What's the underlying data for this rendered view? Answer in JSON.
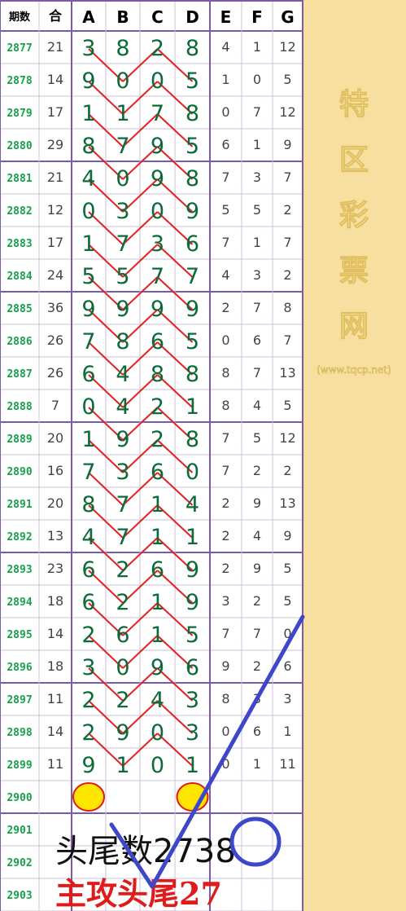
{
  "header": {
    "period": "期数",
    "sum": "合",
    "cols": [
      "A",
      "B",
      "C",
      "D",
      "E",
      "F",
      "G"
    ]
  },
  "rows": [
    {
      "period": "2877",
      "sum": "21",
      "digits": [
        3,
        8,
        2,
        8
      ],
      "efg": [
        "4",
        "1",
        "12"
      ]
    },
    {
      "period": "2878",
      "sum": "14",
      "digits": [
        9,
        0,
        0,
        5
      ],
      "efg": [
        "1",
        "0",
        "5"
      ]
    },
    {
      "period": "2879",
      "sum": "17",
      "digits": [
        1,
        1,
        7,
        8
      ],
      "efg": [
        "0",
        "7",
        "12"
      ]
    },
    {
      "period": "2880",
      "sum": "29",
      "digits": [
        8,
        7,
        9,
        5
      ],
      "efg": [
        "6",
        "1",
        "9"
      ]
    },
    {
      "period": "2881",
      "sum": "21",
      "digits": [
        4,
        0,
        9,
        8
      ],
      "efg": [
        "7",
        "3",
        "7"
      ]
    },
    {
      "period": "2882",
      "sum": "12",
      "digits": [
        0,
        3,
        0,
        9
      ],
      "efg": [
        "5",
        "5",
        "2"
      ]
    },
    {
      "period": "2883",
      "sum": "17",
      "digits": [
        1,
        7,
        3,
        6
      ],
      "efg": [
        "7",
        "1",
        "7"
      ]
    },
    {
      "period": "2884",
      "sum": "24",
      "digits": [
        5,
        5,
        7,
        7
      ],
      "efg": [
        "4",
        "3",
        "2"
      ]
    },
    {
      "period": "2885",
      "sum": "36",
      "digits": [
        9,
        9,
        9,
        9
      ],
      "efg": [
        "2",
        "7",
        "8"
      ]
    },
    {
      "period": "2886",
      "sum": "26",
      "digits": [
        7,
        8,
        6,
        5
      ],
      "efg": [
        "0",
        "6",
        "7"
      ]
    },
    {
      "period": "2887",
      "sum": "26",
      "digits": [
        6,
        4,
        8,
        8
      ],
      "efg": [
        "8",
        "7",
        "13"
      ]
    },
    {
      "period": "2888",
      "sum": "7",
      "digits": [
        0,
        4,
        2,
        1
      ],
      "efg": [
        "8",
        "4",
        "5"
      ]
    },
    {
      "period": "2889",
      "sum": "20",
      "digits": [
        1,
        9,
        2,
        8
      ],
      "efg": [
        "7",
        "5",
        "12"
      ]
    },
    {
      "period": "2890",
      "sum": "16",
      "digits": [
        7,
        3,
        6,
        0
      ],
      "efg": [
        "7",
        "2",
        "2"
      ]
    },
    {
      "period": "2891",
      "sum": "20",
      "digits": [
        8,
        7,
        1,
        4
      ],
      "efg": [
        "2",
        "9",
        "13"
      ]
    },
    {
      "period": "2892",
      "sum": "13",
      "digits": [
        4,
        7,
        1,
        1
      ],
      "efg": [
        "2",
        "4",
        "9"
      ]
    },
    {
      "period": "2893",
      "sum": "23",
      "digits": [
        6,
        2,
        6,
        9
      ],
      "efg": [
        "2",
        "9",
        "5"
      ]
    },
    {
      "period": "2894",
      "sum": "18",
      "digits": [
        6,
        2,
        1,
        9
      ],
      "efg": [
        "3",
        "2",
        "5"
      ]
    },
    {
      "period": "2895",
      "sum": "14",
      "digits": [
        2,
        6,
        1,
        5
      ],
      "efg": [
        "7",
        "7",
        "0"
      ]
    },
    {
      "period": "2896",
      "sum": "18",
      "digits": [
        3,
        0,
        9,
        6
      ],
      "efg": [
        "9",
        "2",
        "6"
      ]
    },
    {
      "period": "2897",
      "sum": "11",
      "digits": [
        2,
        2,
        4,
        3
      ],
      "efg": [
        "8",
        "3",
        "3"
      ]
    },
    {
      "period": "2898",
      "sum": "14",
      "digits": [
        2,
        9,
        0,
        3
      ],
      "efg": [
        "0",
        "6",
        "1"
      ]
    },
    {
      "period": "2899",
      "sum": "11",
      "digits": [
        9,
        1,
        0,
        1
      ],
      "efg": [
        "0",
        "1",
        "11"
      ]
    },
    {
      "period": "2900",
      "sum": "",
      "digits": [],
      "efg": [
        "",
        "",
        ""
      ]
    },
    {
      "period": "2901",
      "sum": "",
      "digits": [],
      "efg": [
        "",
        "",
        ""
      ]
    },
    {
      "period": "2902",
      "sum": "",
      "digits": [],
      "efg": [
        "",
        "",
        ""
      ]
    },
    {
      "period": "2903",
      "sum": "",
      "digits": [],
      "efg": [
        "",
        "",
        ""
      ]
    }
  ],
  "watermark": {
    "chars": [
      "特",
      "区",
      "彩",
      "票",
      "网"
    ],
    "url": "(www.tqcp.net)"
  },
  "annotation": {
    "line1": "头尾数2738",
    "line2": "主攻头尾27"
  },
  "colors": {
    "grid": "#7b5aa6",
    "digits": "#0d6b3a",
    "period": "#17a34a",
    "zigzag": "#e52020",
    "marks": "#3e47c9",
    "circle_fill": "#ffe600",
    "circle_stroke": "#e21a1a",
    "side_panel": "#f7dfa0",
    "line2": "#e01b1b"
  }
}
